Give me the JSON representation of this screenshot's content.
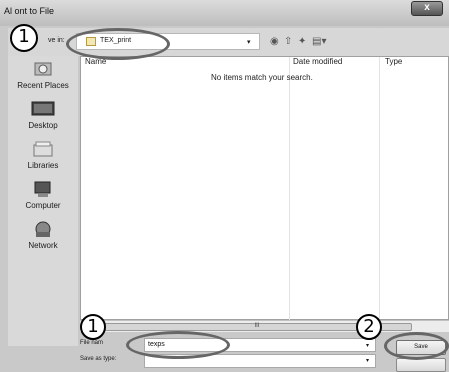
{
  "window": {
    "title": "Al    ont to File",
    "close_label": "x"
  },
  "toolbar": {
    "save_in_label": "ve in:",
    "folder_name": "TEX_print",
    "dropdown_glyph": "▾",
    "icons": [
      "back-icon",
      "up-folder-icon",
      "new-folder-icon",
      "views-menu-icon"
    ]
  },
  "places": [
    {
      "label": "Recent Places",
      "icon": "recent-places-icon"
    },
    {
      "label": "Desktop",
      "icon": "desktop-icon"
    },
    {
      "label": "Libraries",
      "icon": "libraries-icon"
    },
    {
      "label": "Computer",
      "icon": "computer-icon"
    },
    {
      "label": "Network",
      "icon": "network-icon"
    }
  ],
  "file_list": {
    "columns": [
      "Name",
      "Date modified",
      "Type"
    ],
    "empty_message": "No items match your search."
  },
  "scrollbar": {
    "thumb_grip": "III"
  },
  "form": {
    "file_name_label": "File nam",
    "file_name_value": "texps",
    "save_as_type_label": "Save as type:",
    "save_as_type_value": "",
    "save_label": "Save"
  },
  "callouts": {
    "one": "1",
    "two": "2"
  }
}
